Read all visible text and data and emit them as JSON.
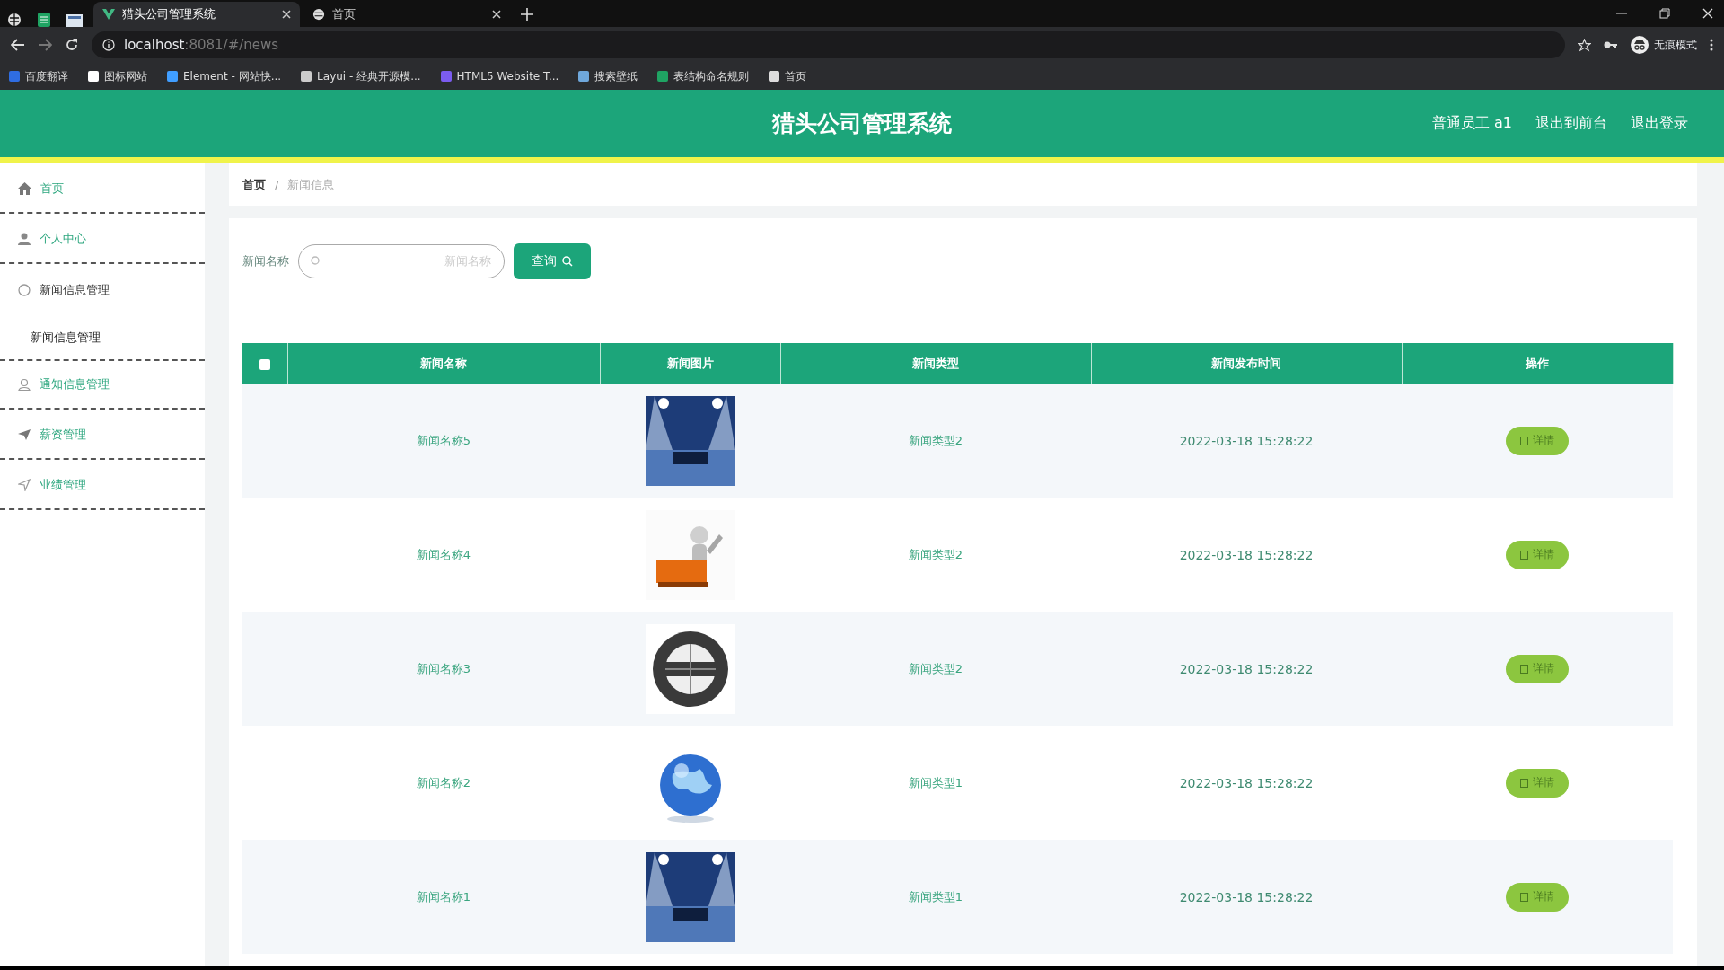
{
  "browser": {
    "tabs": [
      {
        "title": "猎头公司管理系统",
        "selected": true
      },
      {
        "title": "首页",
        "selected": false
      }
    ],
    "url_host": "localhost",
    "url_rest": ":8081/#/news",
    "bookmarks": [
      {
        "label": "百度翻译",
        "color": "#2f6de1"
      },
      {
        "label": "图标网站",
        "color": "#ffffff"
      },
      {
        "label": "Element - 网站快...",
        "color": "#409eff"
      },
      {
        "label": "Layui - 经典开源模...",
        "color": "#cccccc"
      },
      {
        "label": "HTML5 Website T...",
        "color": "#7b5cf0"
      },
      {
        "label": "搜索壁纸",
        "color": "#6fa8dc"
      },
      {
        "label": "表结构命名规则",
        "color": "#1fa463"
      },
      {
        "label": "首页",
        "color": "#dddddd"
      }
    ],
    "profile": "无痕模式"
  },
  "header": {
    "title": "猎头公司管理系统",
    "links": [
      "普通员工 a1",
      "退出到前台",
      "退出登录"
    ]
  },
  "sidebar": {
    "items": [
      {
        "label": "首页",
        "expanded": false
      },
      {
        "label": "个人中心",
        "expanded": false
      },
      {
        "label": "新闻信息管理",
        "expanded": true,
        "children": [
          {
            "label": "新闻信息管理"
          }
        ]
      },
      {
        "label": "通知信息管理",
        "expanded": false
      },
      {
        "label": "薪资管理",
        "expanded": false
      },
      {
        "label": "业绩管理",
        "expanded": false
      }
    ]
  },
  "breadcrumb": {
    "items": [
      "首页",
      "新闻信息"
    ],
    "separator": "/"
  },
  "search": {
    "label": "新闻名称",
    "placeholder": "新闻名称",
    "button": "查询"
  },
  "table": {
    "header_checkbox": {
      "checked": false
    },
    "columns": [
      "新闻名称",
      "新闻图片",
      "新闻类型",
      "新闻发布时间",
      "操作"
    ],
    "rows": [
      {
        "name": "新闻名称5",
        "type": "新闻类型2",
        "time": "2022-03-18 15:28:22",
        "action": "详情"
      },
      {
        "name": "新闻名称4",
        "type": "新闻类型2",
        "time": "2022-03-18 15:28:22",
        "action": "详情"
      },
      {
        "name": "新闻名称3",
        "type": "新闻类型2",
        "time": "2022-03-18 15:28:22",
        "action": "详情"
      },
      {
        "name": "新闻名称2",
        "type": "新闻类型1",
        "time": "2022-03-18 15:28:22",
        "action": "详情"
      },
      {
        "name": "新闻名称1",
        "type": "新闻类型1",
        "time": "2022-03-18 15:28:22",
        "action": "详情"
      }
    ]
  }
}
